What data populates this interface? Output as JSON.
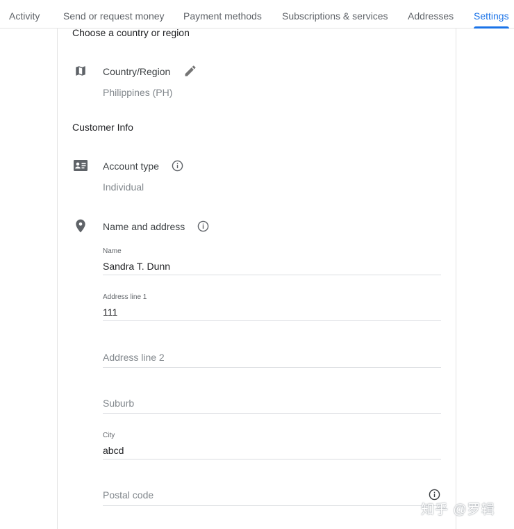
{
  "tabs": [
    {
      "label": "Activity",
      "active": false
    },
    {
      "label": "Send or request money",
      "active": false
    },
    {
      "label": "Payment methods",
      "active": false
    },
    {
      "label": "Subscriptions & services",
      "active": false
    },
    {
      "label": "Addresses",
      "active": false
    },
    {
      "label": "Settings",
      "active": true
    }
  ],
  "country_section": {
    "title": "Choose a country or region",
    "row_label": "Country/Region",
    "row_value": "Philippines (PH)",
    "icon": "map-icon",
    "action_icon": "edit-pencil-icon"
  },
  "customer_section": {
    "title": "Customer Info",
    "account_type": {
      "label": "Account type",
      "value": "Individual",
      "icon": "contact-card-icon",
      "info_icon": "info-icon"
    },
    "name_address": {
      "label": "Name and address",
      "icon": "location-pin-icon",
      "info_icon": "info-icon"
    }
  },
  "form": {
    "name": {
      "label": "Name",
      "value": "Sandra T. Dunn"
    },
    "address1": {
      "label": "Address line 1",
      "value": "111"
    },
    "address2": {
      "placeholder": "Address line 2"
    },
    "suburb": {
      "placeholder": "Suburb"
    },
    "city": {
      "label": "City",
      "value": "abcd"
    },
    "postal": {
      "placeholder": "Postal code",
      "info_icon": "info-icon"
    }
  },
  "watermark": "知乎 @罗辑",
  "colors": {
    "accent": "#1a73e8",
    "icon": "#5f6368",
    "text_secondary": "#80868b",
    "divider": "#dadce0"
  }
}
